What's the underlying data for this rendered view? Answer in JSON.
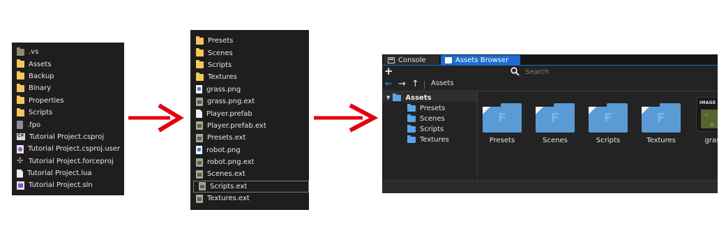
{
  "left_panel": {
    "items": [
      {
        "label": ".vs",
        "icon": "folder-dim"
      },
      {
        "label": "Assets",
        "icon": "folder-yellow"
      },
      {
        "label": "Backup",
        "icon": "folder-yellow"
      },
      {
        "label": "Binary",
        "icon": "folder-yellow"
      },
      {
        "label": "Properties",
        "icon": "folder-yellow"
      },
      {
        "label": "Scripts",
        "icon": "folder-yellow"
      },
      {
        "label": ".fpo",
        "icon": "file-grey"
      },
      {
        "label": "Tutorial Project.csproj",
        "icon": "cs"
      },
      {
        "label": "Tutorial Project.csproj.user",
        "icon": "user"
      },
      {
        "label": "Tutorial Project.forceproj",
        "icon": "force"
      },
      {
        "label": "Tutorial Project.lua",
        "icon": "file-white"
      },
      {
        "label": "Tutorial Project.sln",
        "icon": "vs"
      }
    ]
  },
  "middle_panel": {
    "items": [
      {
        "label": "Presets",
        "icon": "folder-yellow"
      },
      {
        "label": "Scenes",
        "icon": "folder-yellow"
      },
      {
        "label": "Scripts",
        "icon": "folder-yellow"
      },
      {
        "label": "Textures",
        "icon": "folder-yellow"
      },
      {
        "label": "grass.png",
        "icon": "file-img"
      },
      {
        "label": "grass.png.ext",
        "icon": "file-ext"
      },
      {
        "label": "Player.prefab",
        "icon": "file-white"
      },
      {
        "label": "Player.prefab.ext",
        "icon": "file-ext"
      },
      {
        "label": "Presets.ext",
        "icon": "file-ext"
      },
      {
        "label": "robot.png",
        "icon": "file-img"
      },
      {
        "label": "robot.png.ext",
        "icon": "file-ext"
      },
      {
        "label": "Scenes.ext",
        "icon": "file-ext"
      },
      {
        "label": "Scripts.ext",
        "icon": "file-ext",
        "selected": true
      },
      {
        "label": "Textures.ext",
        "icon": "file-ext"
      }
    ]
  },
  "arrow_color": "#e3000f",
  "editor": {
    "tabs": {
      "console": "Console",
      "assets": "Assets Browser"
    },
    "toolbar": {
      "add": "+",
      "search_placeholder": "Search"
    },
    "nav": {
      "back": "←",
      "forward": "→",
      "up": "↑",
      "breadcrumb": "Assets"
    },
    "tree": {
      "root": "Assets",
      "children": [
        "Presets",
        "Scenes",
        "Scripts",
        "Textures"
      ]
    },
    "grid": {
      "folder_letter": "F",
      "items": [
        "Presets",
        "Scenes",
        "Scripts",
        "Textures"
      ],
      "image_item": {
        "label": "grass",
        "tag": "IMAGE"
      }
    },
    "colors": {
      "accent": "#1c6cd0",
      "folder": "#5b9bd5"
    }
  }
}
